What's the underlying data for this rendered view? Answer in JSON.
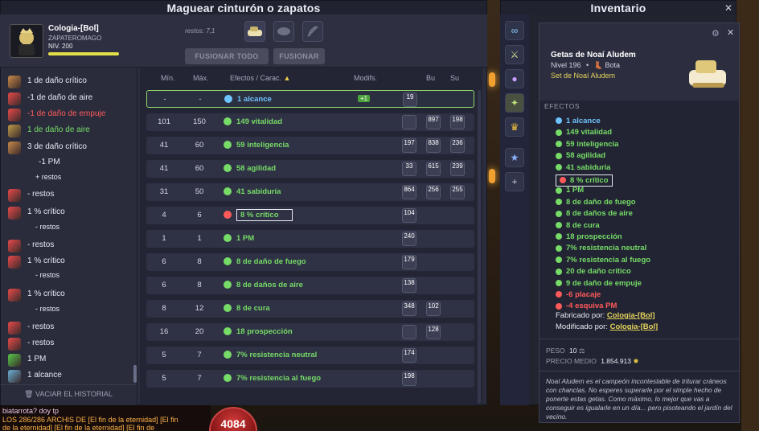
{
  "magueo": {
    "title": "Maguear cinturón o zapatos",
    "character_name": "Cologia-[Bol]",
    "character_job": "ZAPATEROMAGO",
    "level_label": "NIV. 200",
    "leftovers": "restos: 7,1",
    "fuse_all_label": "FUSIONAR TODO",
    "fuse_label": "FUSIONAR",
    "clear_history_label": "VACIAR EL HISTORIAL",
    "columns": {
      "min": "Mín.",
      "max": "Máx.",
      "effects": "Efectos / Carac.",
      "modifs": "Modifs.",
      "bu": "Bu",
      "su": "Su"
    },
    "rows": [
      {
        "min": "-",
        "max": "-",
        "effect": "1 alcance",
        "color": "blue",
        "modif": "+1",
        "runes": [
          "19"
        ]
      },
      {
        "min": "101",
        "max": "150",
        "effect": "149 vitalidad",
        "color": "green",
        "modif": "",
        "runes": [
          "",
          "897",
          "198"
        ]
      },
      {
        "min": "41",
        "max": "60",
        "effect": "59 inteligencia",
        "color": "green",
        "modif": "",
        "runes": [
          "197",
          "838",
          "236"
        ]
      },
      {
        "min": "41",
        "max": "60",
        "effect": "58 agilidad",
        "color": "green",
        "modif": "",
        "runes": [
          "33",
          "615",
          "239"
        ]
      },
      {
        "min": "31",
        "max": "50",
        "effect": "41 sabiduría",
        "color": "green",
        "modif": "",
        "runes": [
          "864",
          "256",
          "255"
        ]
      },
      {
        "min": "4",
        "max": "6",
        "effect": "8 % crítico",
        "color": "green",
        "modif": "",
        "runes": [
          "104"
        ]
      },
      {
        "min": "1",
        "max": "1",
        "effect": "1 PM",
        "color": "green",
        "modif": "",
        "runes": [
          "240"
        ]
      },
      {
        "min": "6",
        "max": "8",
        "effect": "8 de daño de fuego",
        "color": "green",
        "modif": "",
        "runes": [
          "179"
        ]
      },
      {
        "min": "6",
        "max": "8",
        "effect": "8 de daños de aire",
        "color": "green",
        "modif": "",
        "runes": [
          "138"
        ]
      },
      {
        "min": "8",
        "max": "12",
        "effect": "8 de cura",
        "color": "green",
        "modif": "",
        "runes": [
          "348",
          "102"
        ]
      },
      {
        "min": "16",
        "max": "20",
        "effect": "18 prospección",
        "color": "green",
        "modif": "",
        "runes": [
          "",
          "128"
        ]
      },
      {
        "min": "5",
        "max": "7",
        "effect": "7% resistencia neutral",
        "color": "green",
        "modif": "",
        "runes": [
          "174"
        ]
      },
      {
        "min": "5",
        "max": "7",
        "effect": "7% resistencia al fuego",
        "color": "green",
        "modif": "",
        "runes": [
          "198"
        ]
      }
    ],
    "history": [
      {
        "text": "1 de daño crítico",
        "color": "white"
      },
      {
        "text": "-1 de daño de aire",
        "color": "white"
      },
      {
        "text": "-1 de daño de empuje",
        "color": "red"
      },
      {
        "text": "1 de daño de aire",
        "color": "green"
      },
      {
        "text": "3 de daño crítico",
        "color": "white"
      },
      {
        "text": "-1 PM",
        "color": "white"
      },
      {
        "text": "+ restos",
        "color": "white"
      },
      {
        "text": "- restos",
        "color": "white"
      },
      {
        "text": "1 % crítico",
        "color": "white"
      },
      {
        "text": "- restos",
        "color": "white"
      },
      {
        "text": "- restos",
        "color": "white"
      },
      {
        "text": "1 % crítico",
        "color": "white"
      },
      {
        "text": "- restos",
        "color": "white"
      },
      {
        "text": "1 % crítico",
        "color": "white"
      },
      {
        "text": "- restos",
        "color": "white"
      },
      {
        "text": "- restos",
        "color": "white"
      },
      {
        "text": "- restos",
        "color": "white"
      },
      {
        "text": "1 PM",
        "color": "white"
      },
      {
        "text": "1 alcance",
        "color": "white"
      }
    ]
  },
  "inventory": {
    "title": "Inventario"
  },
  "tooltip": {
    "item_name": "Getas de Noaí Aludem",
    "level": "Nivel 196",
    "type": "Bota",
    "set_name": "Set de Noaí Aludem",
    "effects_label": "EFECTOS",
    "effects": [
      {
        "text": "1 alcance",
        "color": "blue"
      },
      {
        "text": "149 vitalidad",
        "color": "green"
      },
      {
        "text": "59 inteligencia",
        "color": "green"
      },
      {
        "text": "58 agilidad",
        "color": "green"
      },
      {
        "text": "41 sabiduría",
        "color": "green"
      },
      {
        "text": "8 % crítico",
        "color": "green"
      },
      {
        "text": "1 PM",
        "color": "green"
      },
      {
        "text": "8 de daño de fuego",
        "color": "green"
      },
      {
        "text": "8 de daños de aire",
        "color": "green"
      },
      {
        "text": "8 de cura",
        "color": "green"
      },
      {
        "text": "18 prospección",
        "color": "green"
      },
      {
        "text": "7% resistencia neutral",
        "color": "green"
      },
      {
        "text": "7% resistencia al fuego",
        "color": "green"
      },
      {
        "text": "20 de daño crítico",
        "color": "green"
      },
      {
        "text": "9 de daño de empuje",
        "color": "green"
      },
      {
        "text": "-6 placaje",
        "color": "red"
      },
      {
        "text": "-4 esquiva PM",
        "color": "red"
      }
    ],
    "crafted_by_label": "Fabricado por:",
    "crafted_by": "Cologia-[Bol]",
    "modified_by_label": "Modificado por:",
    "modified_by": "Cologia-[Bol]",
    "weight_label": "PESO",
    "weight": "10",
    "avg_price_label": "PRECIO MEDIO",
    "avg_price": "1.854.913",
    "lore": "Noaí Aludem es el campeón incontestable de triturar cráneos con chanclas. No esperes superarle por el simple hecho de ponerte estas getas. Como máximo, lo mejor que vas a conseguir es igualarle en un día... pero pisoteando el jardín del vecino."
  },
  "chat": {
    "line1": "biatarrota? doy tp",
    "line2": "LOS 286/286 ARCHIS DE [El fin de la eternidad] [El fin",
    "line3": "de la eternidad] [El fin de la eternidad] [El fin de"
  },
  "hud": {
    "hp": "4084"
  },
  "colors": {
    "blue": "#6ec4ff",
    "green": "#76dc67",
    "red": "#ff5a5a",
    "white": "#e8e9f2",
    "highlight": "#8fd96a"
  }
}
